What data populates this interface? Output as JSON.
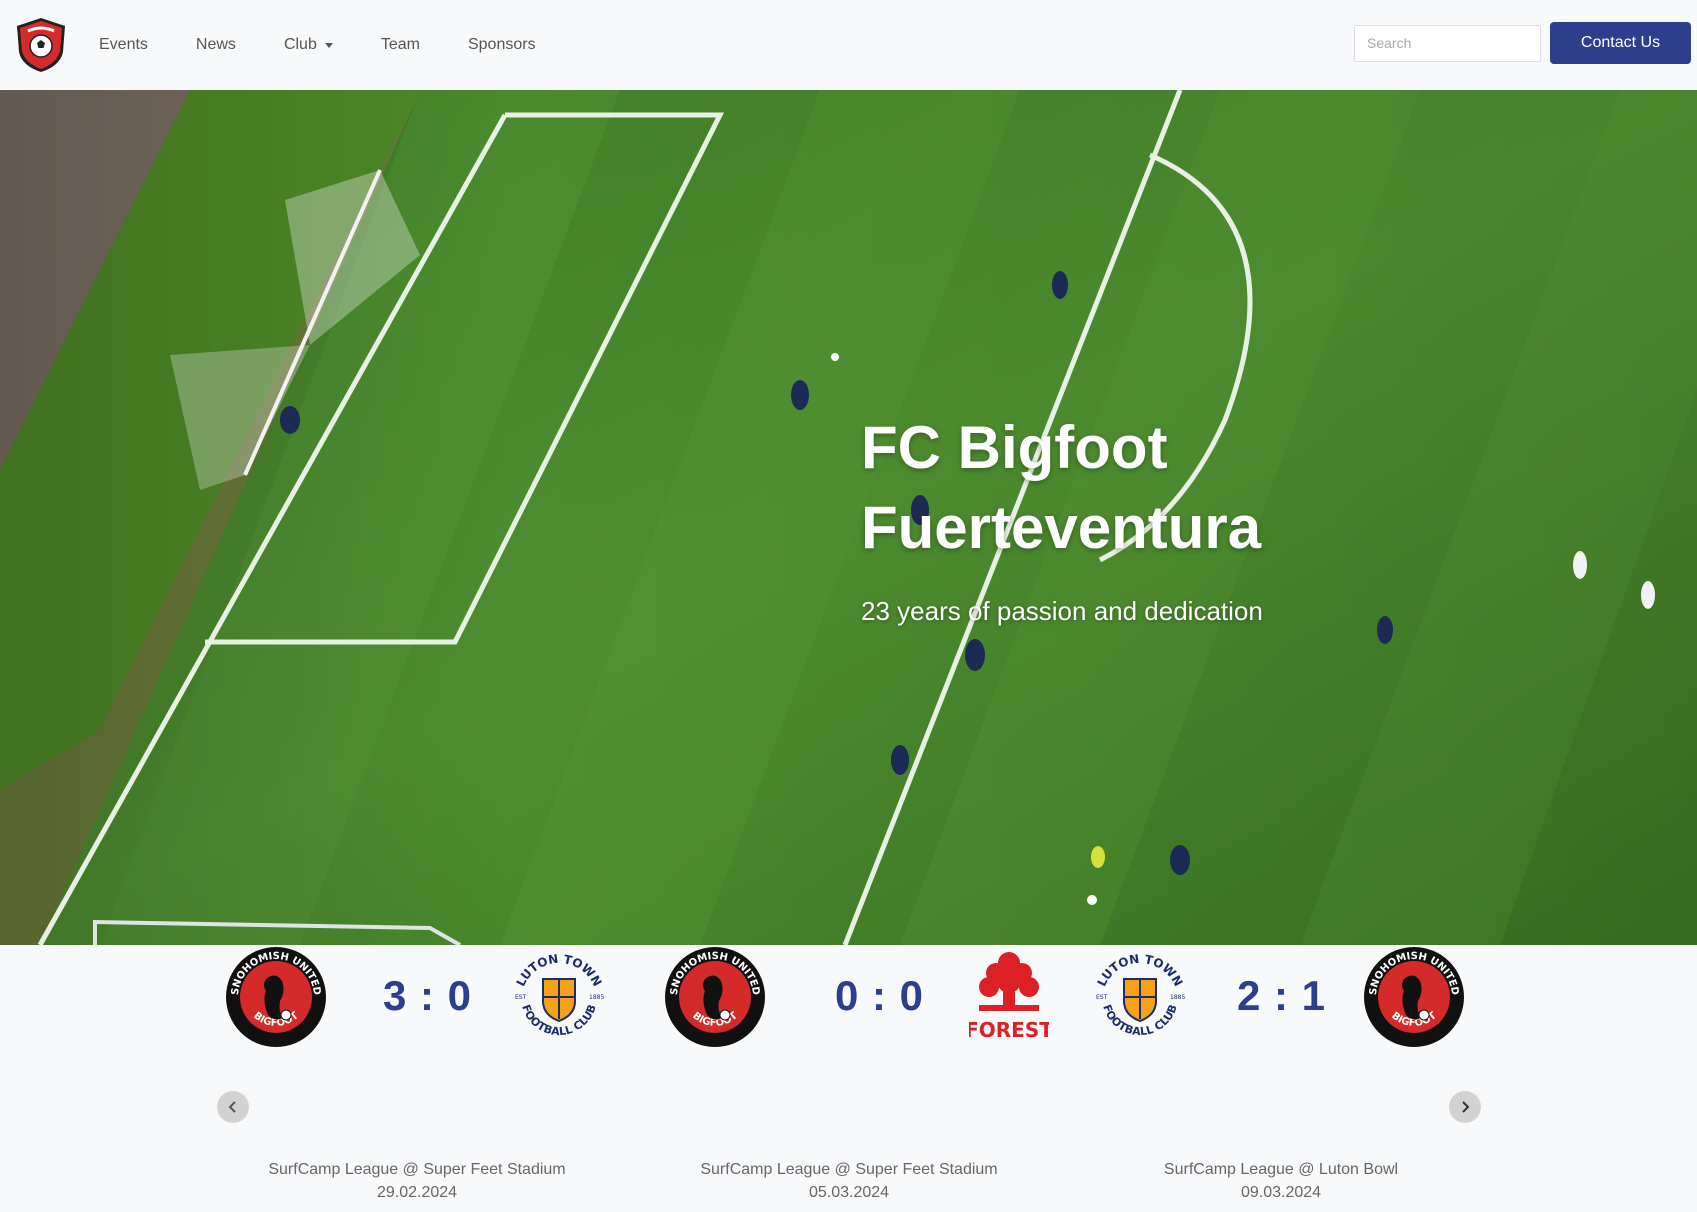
{
  "nav": {
    "logo_alt": "FC Bigfoot",
    "items": [
      {
        "label": "Events"
      },
      {
        "label": "News"
      },
      {
        "label": "Club",
        "has_dropdown": true
      },
      {
        "label": "Team"
      },
      {
        "label": "Sponsors"
      }
    ],
    "search_placeholder": "Search",
    "contact_label": "Contact Us"
  },
  "hero": {
    "title_line1": "FC Bigfoot",
    "title_line2": "Fuerteventura",
    "subtitle": "23 years of passion and dedication"
  },
  "matches": [
    {
      "home_crest": "snohomish-united-bigfoot-crest",
      "away_crest": "luton-town-crest",
      "score": "3 : 0",
      "competition": "SurfCamp League @ Super Feet Stadium",
      "date": "29.02.2024"
    },
    {
      "home_crest": "snohomish-united-bigfoot-crest",
      "away_crest": "nottingham-forest-crest",
      "score": "0 : 0",
      "competition": "SurfCamp League @ Super Feet Stadium",
      "date": "05.03.2024"
    },
    {
      "home_crest": "luton-town-crest",
      "away_crest": "snohomish-united-bigfoot-crest",
      "score": "2 : 1",
      "competition": "SurfCamp League @ Luton Bowl",
      "date": "09.03.2024"
    }
  ],
  "crest_text": {
    "snohomish_top": "SNOHOMISH UNITED",
    "snohomish_bottom": "BIGFOOT",
    "luton_top": "LUTON TOWN",
    "luton_bottom": "FOOTBALL CLUB",
    "luton_est": "EST",
    "luton_year": "1885",
    "forest": "FOREST"
  },
  "colors": {
    "brand_blue": "#2d3e8c",
    "navbar_bg": "#f8f9fa",
    "field_green": "#4a8a2e"
  }
}
